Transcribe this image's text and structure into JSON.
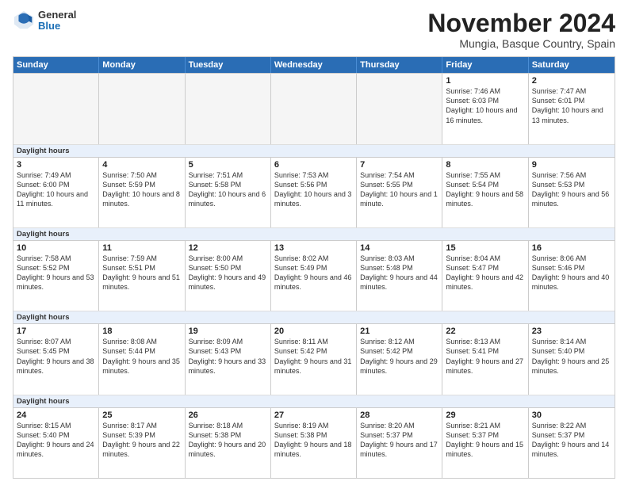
{
  "logo": {
    "general": "General",
    "blue": "Blue"
  },
  "title": "November 2024",
  "subtitle": "Mungia, Basque Country, Spain",
  "days_header": [
    "Sunday",
    "Monday",
    "Tuesday",
    "Wednesday",
    "Thursday",
    "Friday",
    "Saturday"
  ],
  "daylight_label": "Daylight hours",
  "weeks": [
    [
      {
        "day": "",
        "info": "",
        "empty": true
      },
      {
        "day": "",
        "info": "",
        "empty": true
      },
      {
        "day": "",
        "info": "",
        "empty": true
      },
      {
        "day": "",
        "info": "",
        "empty": true
      },
      {
        "day": "",
        "info": "",
        "empty": true
      },
      {
        "day": "1",
        "info": "Sunrise: 7:46 AM\nSunset: 6:03 PM\nDaylight: 10 hours and 16 minutes."
      },
      {
        "day": "2",
        "info": "Sunrise: 7:47 AM\nSunset: 6:01 PM\nDaylight: 10 hours and 13 minutes."
      }
    ],
    [
      {
        "day": "3",
        "info": "Sunrise: 7:49 AM\nSunset: 6:00 PM\nDaylight: 10 hours and 11 minutes."
      },
      {
        "day": "4",
        "info": "Sunrise: 7:50 AM\nSunset: 5:59 PM\nDaylight: 10 hours and 8 minutes."
      },
      {
        "day": "5",
        "info": "Sunrise: 7:51 AM\nSunset: 5:58 PM\nDaylight: 10 hours and 6 minutes."
      },
      {
        "day": "6",
        "info": "Sunrise: 7:53 AM\nSunset: 5:56 PM\nDaylight: 10 hours and 3 minutes."
      },
      {
        "day": "7",
        "info": "Sunrise: 7:54 AM\nSunset: 5:55 PM\nDaylight: 10 hours and 1 minute."
      },
      {
        "day": "8",
        "info": "Sunrise: 7:55 AM\nSunset: 5:54 PM\nDaylight: 9 hours and 58 minutes."
      },
      {
        "day": "9",
        "info": "Sunrise: 7:56 AM\nSunset: 5:53 PM\nDaylight: 9 hours and 56 minutes."
      }
    ],
    [
      {
        "day": "10",
        "info": "Sunrise: 7:58 AM\nSunset: 5:52 PM\nDaylight: 9 hours and 53 minutes."
      },
      {
        "day": "11",
        "info": "Sunrise: 7:59 AM\nSunset: 5:51 PM\nDaylight: 9 hours and 51 minutes."
      },
      {
        "day": "12",
        "info": "Sunrise: 8:00 AM\nSunset: 5:50 PM\nDaylight: 9 hours and 49 minutes."
      },
      {
        "day": "13",
        "info": "Sunrise: 8:02 AM\nSunset: 5:49 PM\nDaylight: 9 hours and 46 minutes."
      },
      {
        "day": "14",
        "info": "Sunrise: 8:03 AM\nSunset: 5:48 PM\nDaylight: 9 hours and 44 minutes."
      },
      {
        "day": "15",
        "info": "Sunrise: 8:04 AM\nSunset: 5:47 PM\nDaylight: 9 hours and 42 minutes."
      },
      {
        "day": "16",
        "info": "Sunrise: 8:06 AM\nSunset: 5:46 PM\nDaylight: 9 hours and 40 minutes."
      }
    ],
    [
      {
        "day": "17",
        "info": "Sunrise: 8:07 AM\nSunset: 5:45 PM\nDaylight: 9 hours and 38 minutes."
      },
      {
        "day": "18",
        "info": "Sunrise: 8:08 AM\nSunset: 5:44 PM\nDaylight: 9 hours and 35 minutes."
      },
      {
        "day": "19",
        "info": "Sunrise: 8:09 AM\nSunset: 5:43 PM\nDaylight: 9 hours and 33 minutes."
      },
      {
        "day": "20",
        "info": "Sunrise: 8:11 AM\nSunset: 5:42 PM\nDaylight: 9 hours and 31 minutes."
      },
      {
        "day": "21",
        "info": "Sunrise: 8:12 AM\nSunset: 5:42 PM\nDaylight: 9 hours and 29 minutes."
      },
      {
        "day": "22",
        "info": "Sunrise: 8:13 AM\nSunset: 5:41 PM\nDaylight: 9 hours and 27 minutes."
      },
      {
        "day": "23",
        "info": "Sunrise: 8:14 AM\nSunset: 5:40 PM\nDaylight: 9 hours and 25 minutes."
      }
    ],
    [
      {
        "day": "24",
        "info": "Sunrise: 8:15 AM\nSunset: 5:40 PM\nDaylight: 9 hours and 24 minutes."
      },
      {
        "day": "25",
        "info": "Sunrise: 8:17 AM\nSunset: 5:39 PM\nDaylight: 9 hours and 22 minutes."
      },
      {
        "day": "26",
        "info": "Sunrise: 8:18 AM\nSunset: 5:38 PM\nDaylight: 9 hours and 20 minutes."
      },
      {
        "day": "27",
        "info": "Sunrise: 8:19 AM\nSunset: 5:38 PM\nDaylight: 9 hours and 18 minutes."
      },
      {
        "day": "28",
        "info": "Sunrise: 8:20 AM\nSunset: 5:37 PM\nDaylight: 9 hours and 17 minutes."
      },
      {
        "day": "29",
        "info": "Sunrise: 8:21 AM\nSunset: 5:37 PM\nDaylight: 9 hours and 15 minutes."
      },
      {
        "day": "30",
        "info": "Sunrise: 8:22 AM\nSunset: 5:37 PM\nDaylight: 9 hours and 14 minutes."
      }
    ]
  ]
}
